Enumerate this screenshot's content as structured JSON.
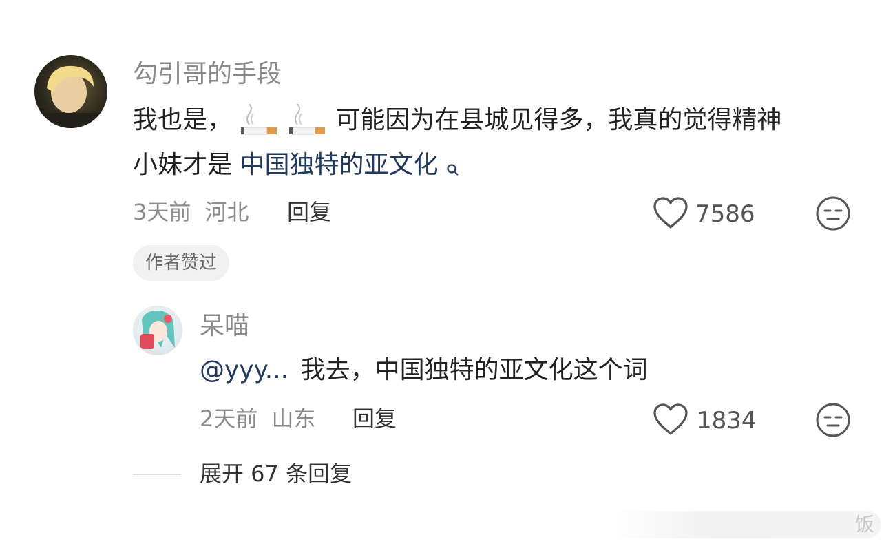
{
  "comment": {
    "username": "勾引哥的手段",
    "text_part1": "我也是，",
    "emoji_names": [
      "cigarette-icon",
      "cigarette-icon"
    ],
    "text_part2": "可能因为在县城见得多，我真的觉得精神",
    "text_line2": "小妹才是",
    "link_text": "中国独特的亚文化",
    "time": "3天前",
    "location": "河北",
    "reply_label": "回复",
    "likes": "7586",
    "badge": "作者赞过"
  },
  "reply": {
    "username": "呆喵",
    "mention": "@yyy...",
    "text": "我去，中国独特的亚文化这个词",
    "time": "2天前",
    "location": "山东",
    "reply_label": "回复",
    "likes": "1834"
  },
  "expand_label": "展开 67 条回复",
  "watermark": "饭"
}
